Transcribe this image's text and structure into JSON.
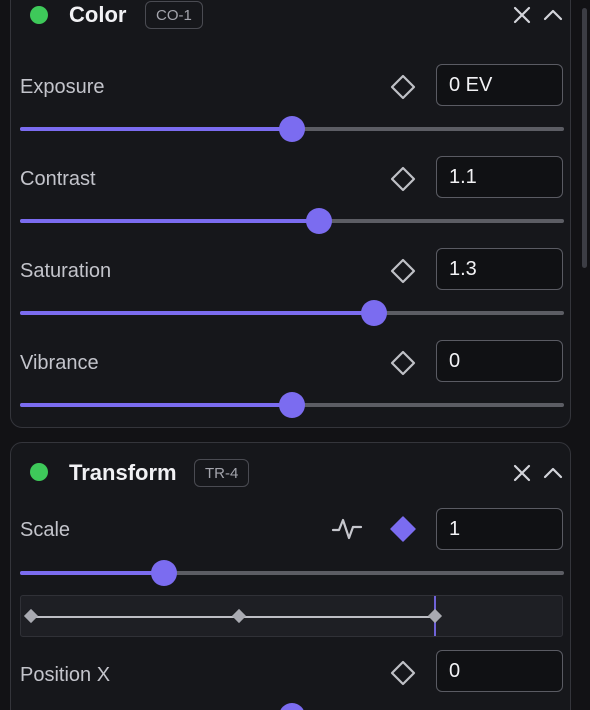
{
  "colors": {
    "accent": "#7b6cf0",
    "status_active": "#3ec95a"
  },
  "panels": [
    {
      "title": "Color",
      "badge": "CO-1",
      "close_icon": "close-icon",
      "collapse_icon": "chevron-up-icon",
      "rows": [
        {
          "label": "Exposure",
          "value": "0 EV",
          "slider": 0.5,
          "keyframe_icon": "diamond-outline-icon"
        },
        {
          "label": "Contrast",
          "value": "1.1",
          "slider": 0.55,
          "keyframe_icon": "diamond-outline-icon"
        },
        {
          "label": "Saturation",
          "value": "1.3",
          "slider": 0.65,
          "keyframe_icon": "diamond-outline-icon"
        },
        {
          "label": "Vibrance",
          "value": "0",
          "slider": 0.5,
          "keyframe_icon": "diamond-outline-icon"
        }
      ]
    },
    {
      "title": "Transform",
      "badge": "TR-4",
      "close_icon": "close-icon",
      "collapse_icon": "chevron-up-icon",
      "rows": [
        {
          "label": "Scale",
          "value": "1",
          "slider": 0.265,
          "keyframe_icon": "diamond-filled-icon",
          "graph_icon": "graph-icon",
          "timeline": {
            "keyframes": [
              0.0,
              0.4,
              0.775
            ],
            "playhead": 0.775
          }
        },
        {
          "label": "Position X",
          "value": "0",
          "slider": 0.5,
          "keyframe_icon": "diamond-outline-icon"
        }
      ]
    }
  ]
}
